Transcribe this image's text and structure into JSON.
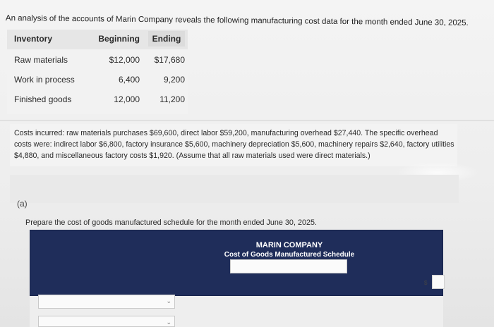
{
  "intro_text": "An analysis of the accounts of Marin Company reveals the following manufacturing cost data for the month ended June 30, 2025.",
  "inventory_table": {
    "headers": [
      "Inventory",
      "Beginning",
      "Ending"
    ],
    "rows": [
      {
        "label": "Raw materials",
        "beginning": "$12,000",
        "ending": "$17,680"
      },
      {
        "label": "Work in process",
        "beginning": "6,400",
        "ending": "9,200"
      },
      {
        "label": "Finished goods",
        "beginning": "12,000",
        "ending": "11,200"
      }
    ]
  },
  "costs_incurred": "Costs incurred: raw materials purchases $69,600, direct labor $59,200, manufacturing overhead $27,440. The specific overhead costs were: indirect labor $6,800, factory insurance $5,600, machinery depreciation $5,600, machinery repairs $2,640, factory utilities $4,880, and miscellaneous factory costs $1,920. (Assume that all raw materials used were direct materials.)",
  "part_label": "(a)",
  "instruction": "Prepare the cost of goods manufactured schedule for the month ended June 30, 2025.",
  "schedule": {
    "company": "MARIN COMPANY",
    "title": "Cost of Goods Manufactured Schedule",
    "header_input_value": "",
    "currency_symbol": "$",
    "amount_value": ""
  },
  "dropdowns": [
    {
      "selected": ""
    },
    {
      "selected": ""
    }
  ],
  "icons": {
    "select_chevron": "chevron-down-icon"
  }
}
